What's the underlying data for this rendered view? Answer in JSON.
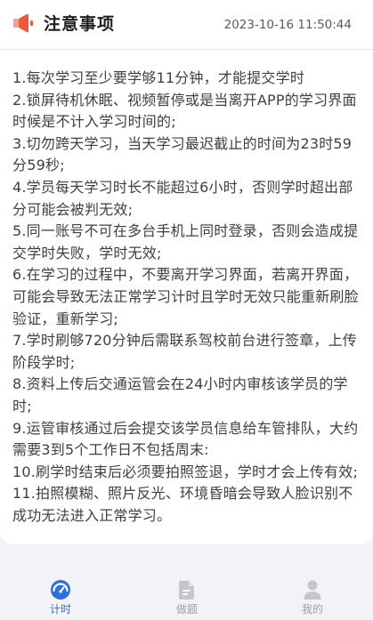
{
  "header": {
    "title": "注意事项",
    "datetime": "2023-10-16 11:50:44",
    "icon": "speaker-icon",
    "accent_color": "#f0563d"
  },
  "notice_items": [
    "1.每次学习至少要学够11分钟，才能提交学时",
    "2.锁屏待机休眠、视频暂停或是当离开APP的学习界面时候是不计入学习时间的;",
    "3.切勿跨天学习，当天学习最迟截止的时间为23时59分59秒;",
    "4.学员每天学习时长不能超过6小时，否则学时超出部分可能会被判无效;",
    "5.同一账号不可在多台手机上同时登录，否则会造成提交学时失败，学时无效;",
    "6.在学习的过程中，不要离开学习界面，若离开界面，可能会导致无法正常学习计时且学时无效只能重新刷脸验证，重新学习;",
    "7.学时刷够720分钟后需联系驾校前台进行签章，上传阶段学时;",
    "8.资料上传后交通运管会在24小时内审核该学员的学时;",
    "9.运管审核通过后会提交该学员信息给车管排队，大约需要3到5个工作日不包括周末:",
    "10.刷学时结束后必须要拍照签退，学时才会上传有效;",
    "11.拍照模糊、照片反光、环境昏暗会导致人脸识别不成功无法进入正常学习。"
  ],
  "tabbar": {
    "tabs": [
      {
        "label": "计时",
        "icon": "timer-icon",
        "active": true
      },
      {
        "label": "做题",
        "icon": "document-icon",
        "active": false
      },
      {
        "label": "我的",
        "icon": "user-icon",
        "active": false
      }
    ],
    "active_color": "#2b6fe0",
    "inactive_color": "#9b9ea4"
  }
}
